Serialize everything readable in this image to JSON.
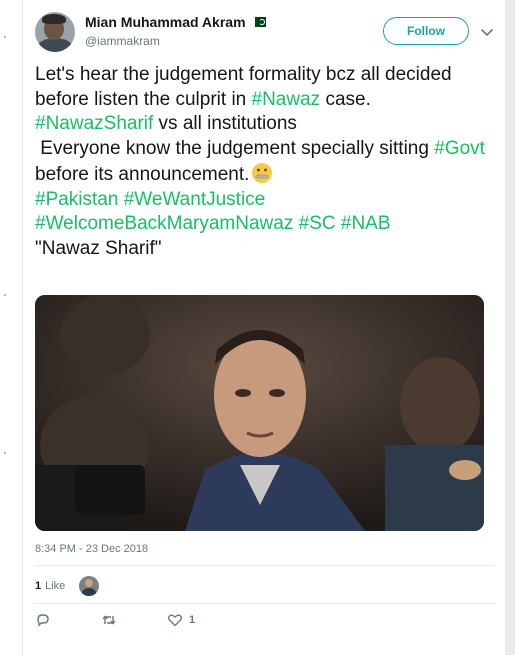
{
  "tweet": {
    "author": {
      "display_name": "Mian Muhammad Akram",
      "handle": "@iammakram",
      "flag_icon": "pakistan-flag-icon"
    },
    "follow_label": "Follow",
    "text_segments": [
      {
        "text": "Let's hear the judgement formality bcz all decided before listen the culprit in ",
        "hashtag": false
      },
      {
        "text": "#Nawaz",
        "hashtag": true
      },
      {
        "text": " case.\n",
        "hashtag": false
      },
      {
        "text": "#NawazSharif",
        "hashtag": true
      },
      {
        "text": " vs all institutions\n Everyone know the judgement specially sitting ",
        "hashtag": false
      },
      {
        "text": "#Govt",
        "hashtag": true
      },
      {
        "text": " before its announcement.",
        "hashtag": false
      },
      {
        "text": "[zipper-mouth-emoji]",
        "emoji": true
      },
      {
        "text": "\n",
        "hashtag": false
      },
      {
        "text": "#Pakistan",
        "hashtag": true
      },
      {
        "text": " ",
        "hashtag": false
      },
      {
        "text": "#WeWantJustice",
        "hashtag": true
      },
      {
        "text": "\n",
        "hashtag": false
      },
      {
        "text": "#WelcomeBackMaryamNawaz",
        "hashtag": true
      },
      {
        "text": " ",
        "hashtag": false
      },
      {
        "text": "#SC",
        "hashtag": true
      },
      {
        "text": " ",
        "hashtag": false
      },
      {
        "text": "#NAB",
        "hashtag": true
      },
      {
        "text": "\n\"Nawaz Sharif\"",
        "hashtag": false
      }
    ],
    "media": {
      "kind": "photo"
    },
    "timestamp": "8:34 PM - 23 Dec 2018",
    "likes": {
      "count": "1",
      "label": "Like"
    },
    "actions": {
      "reply_icon": "reply-icon",
      "retweet_icon": "retweet-icon",
      "like_icon": "heart-icon",
      "like_count": "1"
    }
  },
  "colors": {
    "hashtag": "#17bf63",
    "follow_accent": "#1da1a1",
    "secondary_text": "#657786",
    "primary_text": "#14171a"
  }
}
